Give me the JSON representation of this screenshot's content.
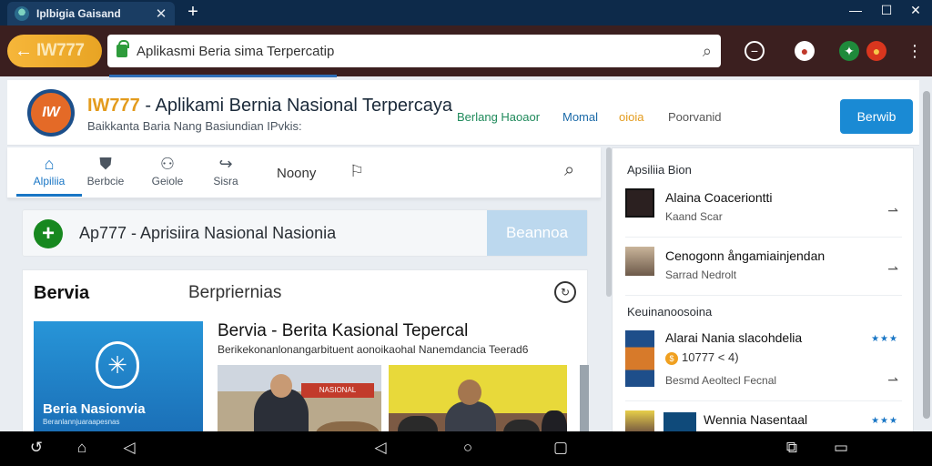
{
  "browser": {
    "tab_title": "Iplbigia Gaisand",
    "new_tab": "+",
    "window_controls": {
      "minimize": "—",
      "maximize": "☐",
      "close": "✕"
    }
  },
  "toolbar": {
    "back_site_label": "IW777",
    "url": "Aplikasmi Beria sima Terpercatip",
    "menu_icon": "⋮"
  },
  "site_header": {
    "logo_text": "IW",
    "title_accent": "IW777",
    "title_rest": " - Aplikami Bernia Nasional Terpercaya",
    "subtitle": "Baikkanta Baria Nang Basiundian IPvkis:",
    "nav": [
      {
        "label": "Berlang Haoaor",
        "color": "#1f8a5b"
      },
      {
        "label": "Momal",
        "color": "#1b6aa8"
      },
      {
        "label": "oioia",
        "color": "#e39b1d"
      },
      {
        "label": "Poorvanid",
        "color": "#555555"
      }
    ],
    "cta_label": "Berwib"
  },
  "icon_nav": {
    "items": [
      {
        "label": "Alpiliia",
        "icon": "home-icon"
      },
      {
        "label": "Berbcie",
        "icon": "shield-icon"
      },
      {
        "label": "Geiole",
        "icon": "people-icon"
      },
      {
        "label": "Sisra",
        "icon": "share-icon"
      }
    ],
    "text_item": "Noony",
    "search_icon": "search-icon"
  },
  "announcement": {
    "text": "Ap777  -  Aprisiira  Nasional Nasionia",
    "button_label": "Beannoa"
  },
  "news_card": {
    "heading": "Bervia",
    "heading2": "Berpriernias",
    "hero_title": "Beria Nasionvia",
    "hero_sub": "Beranlannjuaraapesnas",
    "article_title": "Bervia - Berita Kasional Tepercal",
    "article_sub": "Berikekonanlonangarbituent aonoikaohal Nanemdancia Teerad6",
    "banner_text": "NASIONAL"
  },
  "sidebar": {
    "section1_title": "Apsiliia Bion",
    "items1": [
      {
        "title": "Alaina Coaceriontti",
        "sub": "Kaand Scar"
      },
      {
        "title": "Cenogonn ångamiainjendan",
        "sub": "Sarrad Nedrolt"
      }
    ],
    "section2_title": "Keuinanoosoina",
    "items2": [
      {
        "title": "Alarai Nania slacohdelia",
        "meta": "10777 < 4)",
        "sub": "Besmd Aeoltecl Fecnal",
        "stars": "★★★"
      },
      {
        "title": "Wennia Nasentaal",
        "stars": "★★★"
      }
    ]
  },
  "system_nav": {
    "buttons": [
      "back",
      "home",
      "recents",
      "nav-back",
      "nav-home",
      "nav-recents",
      "screenshot",
      "window"
    ]
  }
}
